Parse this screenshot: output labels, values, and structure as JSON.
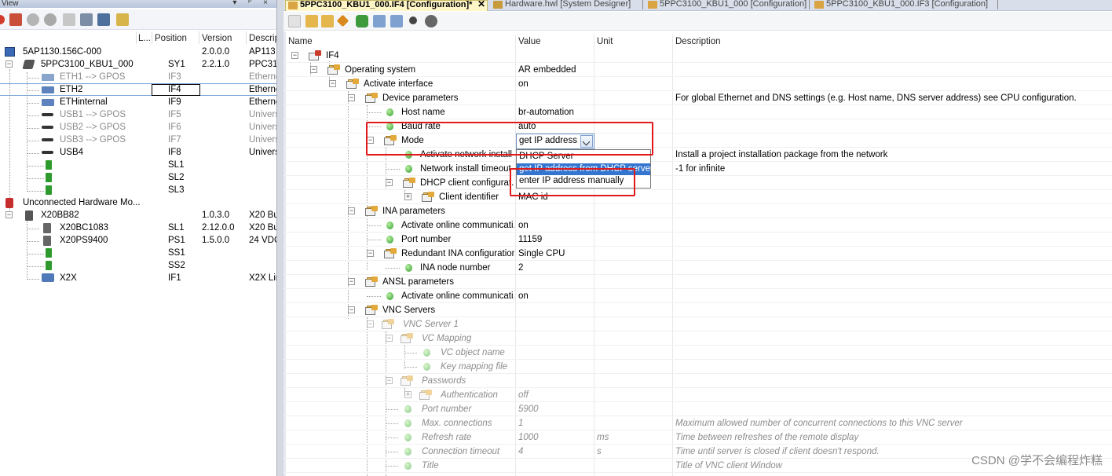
{
  "left_panel": {
    "title": "View",
    "columns": [
      "L...",
      "Position",
      "Version",
      "Descrip"
    ],
    "rows": [
      {
        "name": "5AP1130.156C-000",
        "position": "",
        "version": "2.0.0.0",
        "desc": "AP113"
      },
      {
        "name": "5PPC3100_KBU1_000",
        "position": "SY1",
        "version": "2.2.1.0",
        "desc": "PPC31"
      },
      {
        "name": "ETH1 --> GPOS",
        "position": "IF3",
        "version": "",
        "desc": "Etherne"
      },
      {
        "name": "ETH2",
        "position": "IF4",
        "version": "",
        "desc": "Etherne"
      },
      {
        "name": "ETHinternal",
        "position": "IF9",
        "version": "",
        "desc": "Etherne"
      },
      {
        "name": "USB1 --> GPOS",
        "position": "IF5",
        "version": "",
        "desc": "Univers"
      },
      {
        "name": "USB2 --> GPOS",
        "position": "IF6",
        "version": "",
        "desc": "Univers"
      },
      {
        "name": "USB3 --> GPOS",
        "position": "IF7",
        "version": "",
        "desc": "Univers"
      },
      {
        "name": "USB4",
        "position": "IF8",
        "version": "",
        "desc": "Univers"
      },
      {
        "name": "",
        "position": "SL1",
        "version": "",
        "desc": ""
      },
      {
        "name": "",
        "position": "SL2",
        "version": "",
        "desc": ""
      },
      {
        "name": "",
        "position": "SL3",
        "version": "",
        "desc": ""
      },
      {
        "name": "Unconnected Hardware Mo...",
        "position": "",
        "version": "",
        "desc": ""
      },
      {
        "name": "X20BB82",
        "position": "",
        "version": "1.0.3.0",
        "desc": "X20 Bu"
      },
      {
        "name": "X20BC1083",
        "position": "SL1",
        "version": "2.12.0.0",
        "desc": "X20 Bu"
      },
      {
        "name": "X20PS9400",
        "position": "PS1",
        "version": "1.5.0.0",
        "desc": "24 VDC"
      },
      {
        "name": "",
        "position": "SS1",
        "version": "",
        "desc": ""
      },
      {
        "name": "",
        "position": "SS2",
        "version": "",
        "desc": ""
      },
      {
        "name": "X2X",
        "position": "IF1",
        "version": "",
        "desc": "X2X Lin"
      }
    ]
  },
  "tabs": [
    {
      "label": "5PPC3100_KBU1_000.IF4 [Configuration]*",
      "active": true
    },
    {
      "label": "Hardware.hwl [System Designer]",
      "active": false
    },
    {
      "label": "5PPC3100_KBU1_000 [Configuration]",
      "active": false
    },
    {
      "label": "5PPC3100_KBU1_000.IF3 [Configuration]",
      "active": false
    }
  ],
  "grid": {
    "columns": [
      "Name",
      "Value",
      "Unit",
      "Description"
    ],
    "rows": [
      {
        "name": "IF4",
        "value": "",
        "unit": "",
        "desc": ""
      },
      {
        "name": "Operating system",
        "value": "AR embedded",
        "unit": "",
        "desc": ""
      },
      {
        "name": "Activate interface",
        "value": "on",
        "unit": "",
        "desc": ""
      },
      {
        "name": "Device parameters",
        "value": "",
        "unit": "",
        "desc": "For global Ethernet and DNS settings (e.g. Host name, DNS server address) see CPU configuration."
      },
      {
        "name": "Host name",
        "value": "br-automation",
        "unit": "",
        "desc": ""
      },
      {
        "name": "Baud rate",
        "value": "auto",
        "unit": "",
        "desc": ""
      },
      {
        "name": "Mode",
        "value": "",
        "unit": "",
        "desc": ""
      },
      {
        "name": "Activate network install",
        "value": "",
        "unit": "",
        "desc": "Install a project installation package from the network"
      },
      {
        "name": "Network install timeout",
        "value": "",
        "unit": "",
        "desc": "-1 for infinite"
      },
      {
        "name": "DHCP client configurat...",
        "value": "",
        "unit": "",
        "desc": ""
      },
      {
        "name": "Client identifier",
        "value": "MAC id",
        "unit": "",
        "desc": ""
      },
      {
        "name": "INA parameters",
        "value": "",
        "unit": "",
        "desc": ""
      },
      {
        "name": "Activate online communicati...",
        "value": "on",
        "unit": "",
        "desc": ""
      },
      {
        "name": "Port number",
        "value": "11159",
        "unit": "",
        "desc": ""
      },
      {
        "name": "Redundant INA configuration",
        "value": "Single CPU",
        "unit": "",
        "desc": ""
      },
      {
        "name": "INA node number",
        "value": "2",
        "unit": "",
        "desc": ""
      },
      {
        "name": "ANSL parameters",
        "value": "",
        "unit": "",
        "desc": ""
      },
      {
        "name": "Activate online communicati...",
        "value": "on",
        "unit": "",
        "desc": ""
      },
      {
        "name": "VNC Servers",
        "value": "",
        "unit": "",
        "desc": ""
      },
      {
        "name": "VNC Server 1",
        "value": "",
        "unit": "",
        "desc": ""
      },
      {
        "name": "VC Mapping",
        "value": "",
        "unit": "",
        "desc": ""
      },
      {
        "name": "VC object name",
        "value": "",
        "unit": "",
        "desc": ""
      },
      {
        "name": "Key mapping file",
        "value": "",
        "unit": "",
        "desc": ""
      },
      {
        "name": "Passwords",
        "value": "",
        "unit": "",
        "desc": ""
      },
      {
        "name": "Authentication",
        "value": "off",
        "unit": "",
        "desc": ""
      },
      {
        "name": "Port number",
        "value": "5900",
        "unit": "",
        "desc": ""
      },
      {
        "name": "Max. connections",
        "value": "1",
        "unit": "",
        "desc": "Maximum allowed number of concurrent connections to this VNC server"
      },
      {
        "name": "Refresh rate",
        "value": "1000",
        "unit": "ms",
        "desc": "Time between refreshes of the remote display"
      },
      {
        "name": "Connection timeout",
        "value": "4",
        "unit": "s",
        "desc": "Time until server is closed if client doesn't respond."
      },
      {
        "name": "Title",
        "value": "",
        "unit": "",
        "desc": "Title of VNC client Window"
      }
    ]
  },
  "mode_dropdown": {
    "selected": "get IP address",
    "options": [
      "DHCP Server",
      "get IP address from DHCP server",
      "enter IP address manually"
    ],
    "highlighted_index": 1
  },
  "watermark": "CSDN @学不会编程炸糕",
  "colors": {
    "annotation_red": "#e0191b",
    "selection_blue": "#3475cf"
  }
}
